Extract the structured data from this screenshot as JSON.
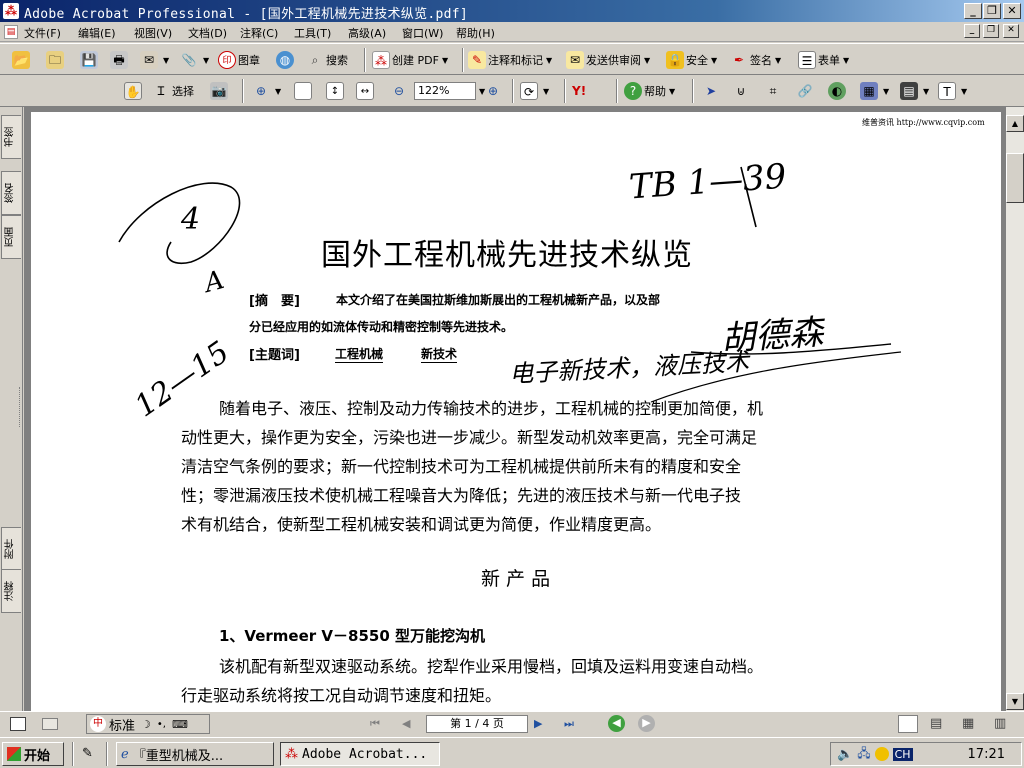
{
  "window": {
    "app_icon": "acrobat-icon",
    "title": "Adobe Acrobat Professional - [国外工程机械先进技术纵览.pdf]",
    "controls": {
      "minimize": "_",
      "restore": "❐",
      "close": "✕"
    }
  },
  "menubar": {
    "items": [
      "文件(F)",
      "编辑(E)",
      "视图(V)",
      "文档(D)",
      "注释(C)",
      "工具(T)",
      "高级(A)",
      "窗口(W)",
      "帮助(H)"
    ]
  },
  "toolbar1": {
    "stamp_label": "图章",
    "search_label": "搜索",
    "create_pdf_label": "创建 PDF",
    "comment_label": "注释和标记",
    "review_label": "发送供审阅",
    "security_label": "安全",
    "sign_label": "签名",
    "forms_label": "表单"
  },
  "toolbar2": {
    "select_label": "选择",
    "zoom_value": "122%",
    "help_label": "帮助"
  },
  "navpane": {
    "tabs_top": [
      "书签",
      "签名",
      "页面"
    ],
    "tabs_bottom": [
      "附件",
      "注释"
    ]
  },
  "document": {
    "header_note": "维普资讯 http://www.cqvip.com",
    "title": "国外工程机械先进技术纵览",
    "abstract_label": "[摘　要]",
    "abstract_text_1": "本文介绍了在美国拉斯维加斯展出的工程机械新产品，以及部",
    "abstract_text_2": "分已经应用的如流体传动和精密控制等先进技术。",
    "keywords_label": "[主题词]",
    "keyword_1": "工程机械",
    "keyword_2": "新技术",
    "body_lines": [
      "随着电子、液压、控制及动力传输技术的进步，工程机械的控制更加简便，机",
      "动性更大，操作更为安全，污染也进一步减少。新型发动机效率更高，完全可满足",
      "清洁空气条例的要求；新一代控制技术可为工程机械提供前所未有的精度和安全",
      "性；零泄漏液压技术使机械工程噪音大为降低；先进的液压技术与新一代电子技",
      "术有机结合，使新型工程机械安装和调试更为简便，作业精度更高。"
    ],
    "section_title": "新 产 品",
    "item_1_title": "1、Vermeer V－8550 型万能挖沟机",
    "item_1_line_1": "该机配有新型双速驱动系统。挖犁作业采用慢档，回填及运料用变速自动档。",
    "item_1_line_2": "行走驱动系统将按工况自动调节速度和扭矩。",
    "handwriting": {
      "h1": "TB 1—39",
      "h2": "4",
      "h3": "A",
      "h4": "12—15",
      "h5": "胡德森",
      "h6": "电子新技术，液压技术"
    }
  },
  "statusbar": {
    "ime_label": "标准",
    "page_indicator": "第 1 / 4 页"
  },
  "taskbar": {
    "start_label": "开始",
    "task_1": "『重型机械及...",
    "task_2": "Adobe Acrobat...",
    "lang": "CH",
    "clock": "17:21"
  }
}
